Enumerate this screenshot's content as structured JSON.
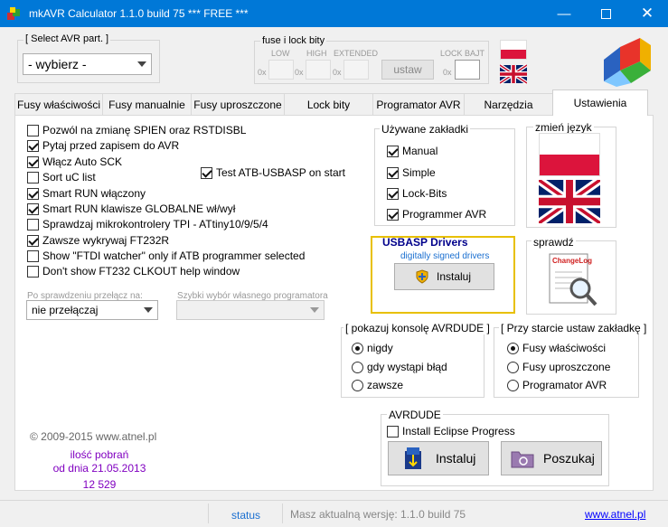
{
  "window": {
    "title": "mkAVR Calculator 1.1.0 build 75   *** FREE ***"
  },
  "avr_part": {
    "group_label": "[ Select AVR part. ]",
    "selected": "- wybierz -"
  },
  "fuse": {
    "group_label": "fuse i lock bity",
    "low": "LOW",
    "high": "HIGH",
    "extended": "EXTENDED",
    "lock": "LOCK BAJT",
    "prefix": "0x",
    "set_button": "ustaw"
  },
  "tabs": [
    "Fusy właściwości",
    "Fusy manualnie",
    "Fusy uproszczone",
    "Lock bity",
    "Programator AVR",
    "Narzędzia",
    "Ustawienia"
  ],
  "active_tab": "Ustawienia",
  "options": [
    {
      "label": "Pozwól na zmianę SPIEN oraz RSTDISBL",
      "checked": false
    },
    {
      "label": "Pytaj przed zapisem do AVR",
      "checked": true
    },
    {
      "label": "Włącz Auto SCK",
      "checked": true
    },
    {
      "label": "Sort uC list",
      "checked": false
    },
    {
      "label": "Smart RUN włączony",
      "checked": true
    },
    {
      "label": "Smart RUN klawisze GLOBALNE wł/wył",
      "checked": true
    },
    {
      "label": "Sprawdzaj mikrokontrolery TPI - ATtiny10/9/5/4",
      "checked": false
    },
    {
      "label": "Zawsze wykrywaj FT232R",
      "checked": true
    },
    {
      "label": "Show \"FTDI watcher\" only if ATB programmer selected",
      "checked": false
    },
    {
      "label": "Don't show FT232 CLKOUT help window",
      "checked": false
    }
  ],
  "test_atb": {
    "label": "Test ATB-USBASP on start",
    "checked": true
  },
  "after_check": {
    "label": "Po sprawdzeniu przełącz na:",
    "selected": "nie przełączaj"
  },
  "quick_select": {
    "label": "Szybki wybór własnego programatora",
    "selected": ""
  },
  "used_tabs": {
    "title": "Używane zakładki",
    "items": [
      {
        "label": "Manual",
        "checked": true
      },
      {
        "label": "Simple",
        "checked": true
      },
      {
        "label": "Lock-Bits",
        "checked": true
      },
      {
        "label": "Programmer AVR",
        "checked": true
      }
    ]
  },
  "language": {
    "title": "zmień język"
  },
  "usbasp": {
    "title": "USBASP Drivers",
    "subtitle": "digitally signed drivers",
    "button": "Instaluj"
  },
  "check": {
    "title": "sprawdź",
    "changelog": "ChangeLog"
  },
  "console": {
    "title": "[ pokazuj konsolę AVRDUDE ]",
    "options": [
      "nigdy",
      "gdy wystąpi błąd",
      "zawsze"
    ],
    "selected": "nigdy"
  },
  "startup": {
    "title": "[ Przy starcie ustaw zakładkę ]",
    "options": [
      "Fusy właściwości",
      "Fusy uproszczone",
      "Programator AVR"
    ],
    "selected": "Fusy właściwości"
  },
  "avrdude": {
    "title": "AVRDUDE",
    "eclipse_label": "Install Eclipse Progress",
    "eclipse_checked": false,
    "install_button": "Instaluj",
    "search_button": "Poszukaj"
  },
  "footer": {
    "copyright": "©  2009-2015    www.atnel.pl",
    "downloads_label": "ilość pobrań",
    "since": "od dnia 21.05.2013",
    "count": "12 529"
  },
  "statusbar": {
    "status": "status",
    "version": "Masz aktualną wersję: 1.1.0 build 75",
    "link": "www.atnel.pl"
  },
  "colors": {
    "titlebar": "#0078d7",
    "accent_purple": "#8000c0",
    "usbasp_title": "#00008b",
    "link": "#0000ff",
    "border_gold": "#e8c000"
  }
}
